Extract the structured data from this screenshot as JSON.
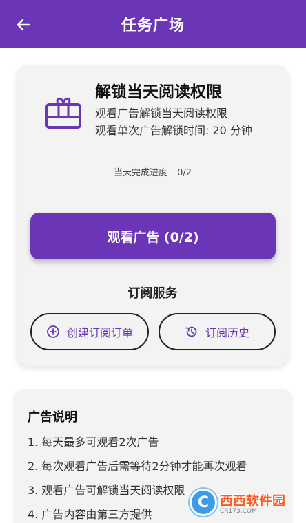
{
  "header": {
    "title": "任务广场",
    "back_icon": "arrow-left-icon"
  },
  "unlock_card": {
    "icon": "gift-box-icon",
    "title": "解锁当天阅读权限",
    "desc_line1": "观看广告解锁当天阅读权限",
    "desc_line2": "观看单次广告解锁时间: 20 分钟",
    "progress_label": "当天完成进度",
    "progress_value": "0/2",
    "watch_button": "观看广告 (0/2)",
    "subscription_title": "订阅服务",
    "create_order_button": "创建订阅订单",
    "history_button": "订阅历史"
  },
  "ad_info": {
    "title": "广告说明",
    "items": [
      "1. 每天最多可观看2次广告",
      "2. 每次观看广告后需等待2分钟才能再次观看",
      "3. 观看广告可解锁当天阅读权限",
      "4. 广告内容由第三方提供"
    ]
  },
  "watermark": {
    "logo_letter": "C",
    "main_text": "西西软件园",
    "sub_text": "CR173.COM"
  },
  "colors": {
    "primary": "#6b35b7",
    "card_bg": "#f3f3f3",
    "watermark_orange": "#ff5a1f"
  }
}
